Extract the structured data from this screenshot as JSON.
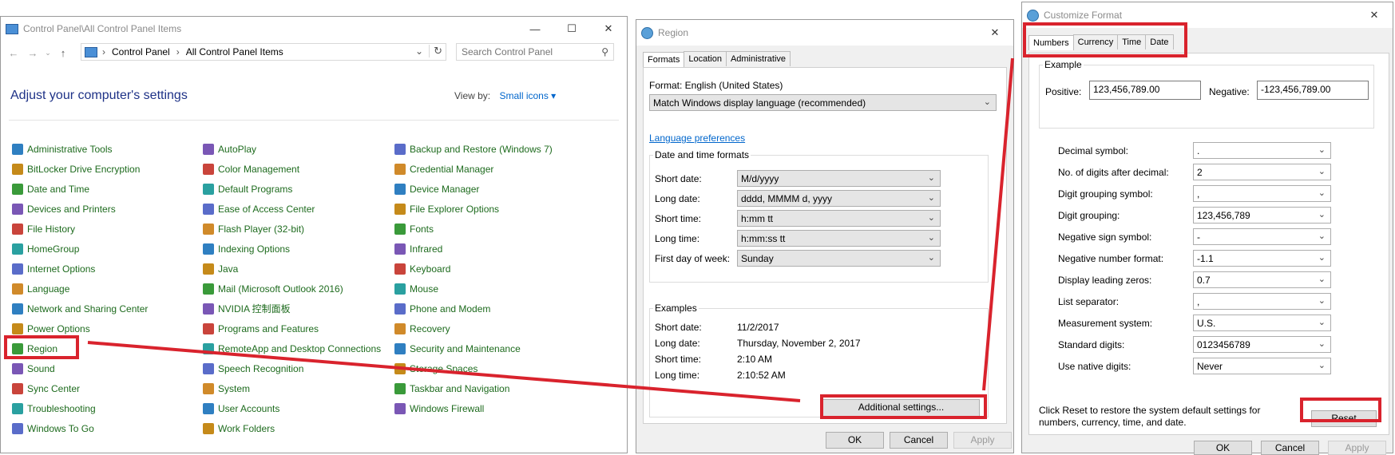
{
  "control_panel": {
    "title": "Control Panel\\All Control Panel Items",
    "breadcrumb": [
      "Control Panel",
      "All Control Panel Items"
    ],
    "search_placeholder": "Search Control Panel",
    "heading": "Adjust your computer's settings",
    "view_by_label": "View by:",
    "view_by_value": "Small icons",
    "columns": [
      [
        "Administrative Tools",
        "BitLocker Drive Encryption",
        "Date and Time",
        "Devices and Printers",
        "File History",
        "HomeGroup",
        "Internet Options",
        "Language",
        "Network and Sharing Center",
        "Power Options",
        "Region",
        "Sound",
        "Sync Center",
        "Troubleshooting",
        "Windows To Go"
      ],
      [
        "AutoPlay",
        "Color Management",
        "Default Programs",
        "Ease of Access Center",
        "Flash Player (32-bit)",
        "Indexing Options",
        "Java",
        "Mail (Microsoft Outlook 2016)",
        "NVIDIA 控制面板",
        "Programs and Features",
        "RemoteApp and Desktop Connections",
        "Speech Recognition",
        "System",
        "User Accounts",
        "Work Folders"
      ],
      [
        "Backup and Restore (Windows 7)",
        "Credential Manager",
        "Device Manager",
        "File Explorer Options",
        "Fonts",
        "Infrared",
        "Keyboard",
        "Mouse",
        "Phone and Modem",
        "Recovery",
        "Security and Maintenance",
        "Storage Spaces",
        "Taskbar and Navigation",
        "Windows Firewall"
      ]
    ]
  },
  "region": {
    "title": "Region",
    "tabs": [
      "Formats",
      "Location",
      "Administrative"
    ],
    "format_label": "Format: English (United States)",
    "format_value": "Match Windows display language (recommended)",
    "language_link": "Language preferences",
    "dt_group": "Date and time formats",
    "fields": [
      {
        "label": "Short date:",
        "value": "M/d/yyyy"
      },
      {
        "label": "Long date:",
        "value": "dddd, MMMM d, yyyy"
      },
      {
        "label": "Short time:",
        "value": "h:mm tt"
      },
      {
        "label": "Long time:",
        "value": "h:mm:ss tt"
      },
      {
        "label": "First day of week:",
        "value": "Sunday"
      }
    ],
    "examples_group": "Examples",
    "examples": [
      {
        "label": "Short date:",
        "value": "11/2/2017"
      },
      {
        "label": "Long date:",
        "value": "Thursday, November 2, 2017"
      },
      {
        "label": "Short time:",
        "value": "2:10 AM"
      },
      {
        "label": "Long time:",
        "value": "2:10:52 AM"
      }
    ],
    "additional_button": "Additional settings...",
    "ok": "OK",
    "cancel": "Cancel",
    "apply": "Apply"
  },
  "customize": {
    "title": "Customize Format",
    "tabs": [
      "Numbers",
      "Currency",
      "Time",
      "Date"
    ],
    "example_group": "Example",
    "positive_label": "Positive:",
    "positive_value": "123,456,789.00",
    "negative_label": "Negative:",
    "negative_value": "-123,456,789.00",
    "settings": [
      {
        "label": "Decimal symbol:",
        "value": "."
      },
      {
        "label": "No. of digits after decimal:",
        "value": "2"
      },
      {
        "label": "Digit grouping symbol:",
        "value": ","
      },
      {
        "label": "Digit grouping:",
        "value": "123,456,789"
      },
      {
        "label": "Negative sign symbol:",
        "value": "-"
      },
      {
        "label": "Negative number format:",
        "value": "-1.1"
      },
      {
        "label": "Display leading zeros:",
        "value": "0.7"
      },
      {
        "label": "List separator:",
        "value": ","
      },
      {
        "label": "Measurement system:",
        "value": "U.S."
      },
      {
        "label": "Standard digits:",
        "value": "0123456789"
      },
      {
        "label": "Use native digits:",
        "value": "Never"
      }
    ],
    "reset_note": "Click Reset to restore the system default settings for numbers, currency, time, and date.",
    "reset": "Reset",
    "ok": "OK",
    "cancel": "Cancel",
    "apply": "Apply"
  },
  "colors": {
    "annotation_red": "#d9232d",
    "link_blue": "#0066cc",
    "item_green": "#1e6b1e",
    "heading_blue": "#1e3287"
  }
}
